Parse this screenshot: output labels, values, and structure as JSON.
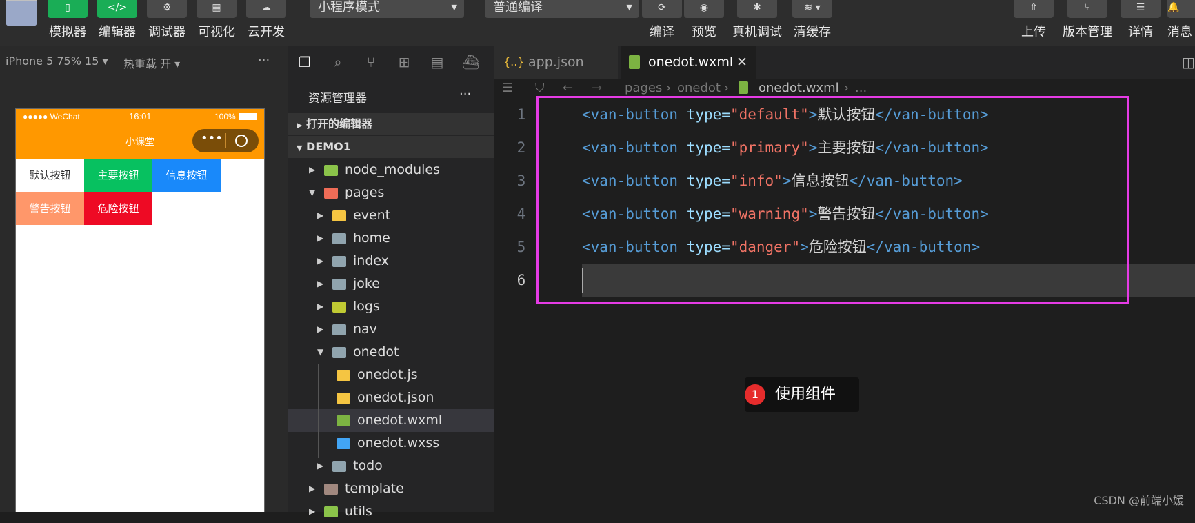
{
  "toolbar": {
    "left_buttons": [
      {
        "label": "模拟器",
        "icon": "phone-icon"
      },
      {
        "label": "编辑器",
        "icon": "code-icon"
      },
      {
        "label": "调试器",
        "icon": "debug-settings-icon"
      },
      {
        "label": "可视化",
        "icon": "layout-icon"
      },
      {
        "label": "云开发",
        "icon": "cloud-icon"
      }
    ],
    "mode_select": "小程序模式",
    "compile_select": "普通编译",
    "center_buttons": [
      {
        "label": "编译",
        "icon": "refresh-icon"
      },
      {
        "label": "预览",
        "icon": "eye-icon"
      },
      {
        "label": "真机调试",
        "icon": "bug-icon"
      },
      {
        "label": "清缓存",
        "icon": "layers-icon"
      }
    ],
    "right_buttons": [
      {
        "label": "上传",
        "icon": "upload-icon"
      },
      {
        "label": "版本管理",
        "icon": "branch-icon"
      },
      {
        "label": "详情",
        "icon": "menu-icon"
      },
      {
        "label": "消息",
        "icon": "bell-icon"
      }
    ]
  },
  "simulator": {
    "device": "iPhone 5 75% 15",
    "hot_reload": "热重载 开",
    "more": "···",
    "status": {
      "carrier": "●●●●● WeChat",
      "time": "16:01",
      "battery": "100%"
    },
    "nav_title": "小课堂",
    "buttons": [
      {
        "label": "默认按钮",
        "bg": "#ffffff",
        "fg": "#323233"
      },
      {
        "label": "主要按钮",
        "bg": "#07c160",
        "fg": "#ffffff"
      },
      {
        "label": "信息按钮",
        "bg": "#1989fa",
        "fg": "#ffffff"
      },
      {
        "label": "警告按钮",
        "bg": "#ff976a",
        "fg": "#ffffff"
      },
      {
        "label": "危险按钮",
        "bg": "#ee0a24",
        "fg": "#ffffff"
      }
    ]
  },
  "explorer": {
    "title": "资源管理器",
    "more": "···",
    "open_editors": "打开的编辑器",
    "project": "DEMO1",
    "tree": [
      {
        "name": "node_modules",
        "color": "#8bc34a"
      },
      {
        "name": "pages",
        "color": "#ef6c57"
      },
      {
        "name": "event",
        "color": "#f5c542"
      },
      {
        "name": "home",
        "color": "#90a4ae"
      },
      {
        "name": "index",
        "color": "#90a4ae"
      },
      {
        "name": "joke",
        "color": "#90a4ae"
      },
      {
        "name": "logs",
        "color": "#c0ca33"
      },
      {
        "name": "nav",
        "color": "#90a4ae"
      },
      {
        "name": "onedot",
        "color": "#90a4ae"
      },
      {
        "name": "onedot.js",
        "color": "#f5c542"
      },
      {
        "name": "onedot.json",
        "color": "#f5c542"
      },
      {
        "name": "onedot.wxml",
        "color": "#7cb342"
      },
      {
        "name": "onedot.wxss",
        "color": "#42a5f5"
      },
      {
        "name": "todo",
        "color": "#90a4ae"
      },
      {
        "name": "template",
        "color": "#a1887f"
      },
      {
        "name": "utils",
        "color": "#8bc34a"
      }
    ]
  },
  "editor": {
    "tabs": [
      "app.json",
      "onedot.wxml"
    ],
    "breadcrumb": {
      "a": "pages",
      "b": "onedot",
      "c": "onedot.wxml",
      "d": "..."
    },
    "lines": [
      {
        "n": "1",
        "open": "<van-button",
        "attr": " type=",
        "val": "\"default\"",
        "close": ">",
        "text": "默认按钮",
        "end": "</van-button>"
      },
      {
        "n": "2",
        "open": "<van-button",
        "attr": " type=",
        "val": "\"primary\"",
        "close": ">",
        "text": "主要按钮",
        "end": "</van-button>"
      },
      {
        "n": "3",
        "open": "<van-button",
        "attr": " type=",
        "val": "\"info\"",
        "close": ">",
        "text": "信息按钮",
        "end": "</van-button>"
      },
      {
        "n": "4",
        "open": "<van-button",
        "attr": " type=",
        "val": "\"warning\"",
        "close": ">",
        "text": "警告按钮",
        "end": "</van-button>"
      },
      {
        "n": "5",
        "open": "<van-button",
        "attr": " type=",
        "val": "\"danger\"",
        "close": ">",
        "text": "危险按钮",
        "end": "</van-button>"
      },
      {
        "n": "6"
      }
    ]
  },
  "annotation": {
    "badge": "1",
    "text": "使用组件",
    "highlight_color": "#e53be5"
  },
  "watermark": "CSDN @前端小媛"
}
